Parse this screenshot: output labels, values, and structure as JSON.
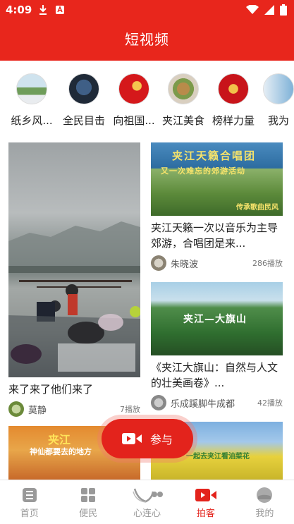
{
  "status_bar": {
    "time": "4:09"
  },
  "header": {
    "title": "短视频"
  },
  "categories": [
    {
      "label": "纸乡风..."
    },
    {
      "label": "全民目击"
    },
    {
      "label": "向祖国..."
    },
    {
      "label": "夹江美食"
    },
    {
      "label": "榜样力量"
    },
    {
      "label": "我为"
    }
  ],
  "videos": [
    {
      "caption": "来了来了他们来了",
      "author": "莫静",
      "plays": "7播放"
    },
    {
      "banner_title": "夹江天籁合唱团",
      "banner_sub": "又一次难忘的郊游活动",
      "banner_tag": "传承歌曲民风",
      "caption": "夹江天籁一次以音乐为主导郊游，合唱团是来...",
      "author": "朱晓波",
      "plays": "286播放"
    },
    {
      "banner_title": "夹江—大旗山",
      "caption": "《夹江大旗山：自然与人文的壮美画卷》...",
      "author": "乐成蹊脚牛成都",
      "plays": "42播放"
    },
    {
      "banner_title": "夹江",
      "banner_sub": "神仙都要去的地方"
    },
    {
      "banner_sub": "一起去夹江看油菜花"
    }
  ],
  "fab": {
    "label": "参与"
  },
  "tabs": [
    {
      "label": "首页"
    },
    {
      "label": "便民"
    },
    {
      "label": "心连心"
    },
    {
      "label": "拍客"
    },
    {
      "label": "我的"
    }
  ],
  "colors": {
    "brand": "#e8261c",
    "active_tab": "#e3231c"
  }
}
